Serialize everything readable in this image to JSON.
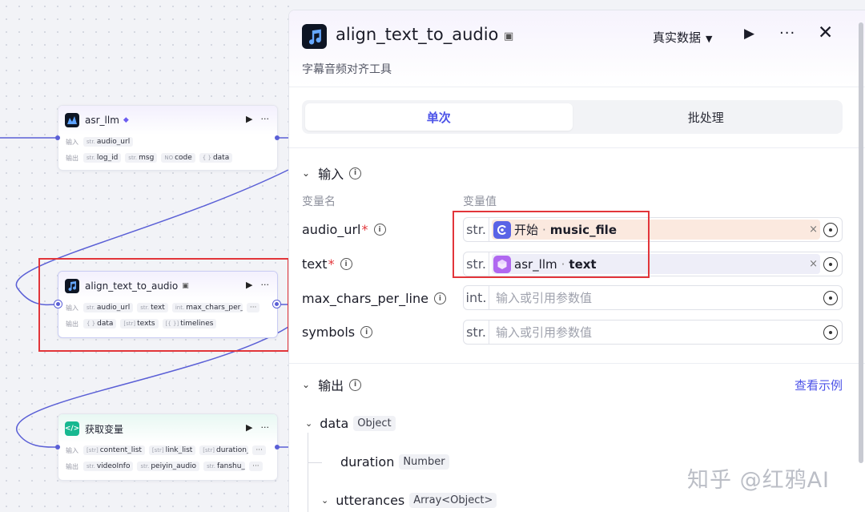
{
  "canvas": {
    "nodes": [
      {
        "title": "asr_llm",
        "badge": "◆",
        "run": "▶",
        "more": "···",
        "input_label": "输入",
        "inputs": [
          {
            "type": "str.",
            "name": "audio_url"
          }
        ],
        "output_label": "输出",
        "outputs": [
          {
            "type": "str.",
            "name": "log_id"
          },
          {
            "type": "str.",
            "name": "msg"
          },
          {
            "type": "NO",
            "name": "code"
          },
          {
            "type": "{ }",
            "name": "data"
          }
        ]
      },
      {
        "title": "align_text_to_audio",
        "badge": "▣",
        "run": "▶",
        "more": "···",
        "input_label": "输入",
        "inputs": [
          {
            "type": "str.",
            "name": "audio_url"
          },
          {
            "type": "str.",
            "name": "text"
          },
          {
            "type": "int.",
            "name": "max_chars_per_"
          }
        ],
        "inputs_more": "···",
        "output_label": "输出",
        "outputs": [
          {
            "type": "{ }",
            "name": "data"
          },
          {
            "type": "[str]",
            "name": "texts"
          },
          {
            "type": "[{ }]",
            "name": "timelines"
          }
        ]
      },
      {
        "title": "获取变量",
        "run": "▶",
        "more": "···",
        "input_label": "输入",
        "inputs": [
          {
            "type": "[str]",
            "name": "content_list"
          },
          {
            "type": "[str]",
            "name": "link_list"
          },
          {
            "type": "[str]",
            "name": "duration_"
          }
        ],
        "inputs_more": "···",
        "output_label": "输出",
        "outputs": [
          {
            "type": "str.",
            "name": "videoInfo"
          },
          {
            "type": "str.",
            "name": "peiyin_audio"
          },
          {
            "type": "str.",
            "name": "fanshu_"
          }
        ],
        "outputs_more": "···"
      }
    ]
  },
  "panel": {
    "title": "align_text_to_audio",
    "title_badge": "▣",
    "subtitle": "字幕音频对齐工具",
    "data_mode": "真实数据",
    "caret": "▼",
    "run_icon": "▶",
    "more_icon": "···",
    "close_icon": "✕",
    "tabs": [
      {
        "label": "单次",
        "active": true
      },
      {
        "label": "批处理",
        "active": false
      }
    ],
    "input_section": {
      "chevron": "⌄",
      "title": "输入",
      "col_name": "变量名",
      "col_value": "变量值",
      "params": [
        {
          "name": "audio_url",
          "required": "*",
          "type": "str.",
          "ref_source": "开始",
          "sep": "·",
          "ref_var": "music_file",
          "clear": "×",
          "placeholder": ""
        },
        {
          "name": "text",
          "required": "*",
          "type": "str.",
          "ref_source": "asr_llm",
          "sep": "·",
          "ref_var": "text",
          "clear": "×",
          "placeholder": ""
        },
        {
          "name": "max_chars_per_line",
          "required": "",
          "type": "int.",
          "placeholder": "输入或引用参数值"
        },
        {
          "name": "symbols",
          "required": "",
          "type": "str.",
          "placeholder": "输入或引用参数值"
        }
      ]
    },
    "output_section": {
      "chevron": "⌄",
      "title": "输出",
      "view_example": "查看示例",
      "items": [
        {
          "chevron": "⌄",
          "name": "data",
          "type": "Object"
        },
        {
          "chevron": "",
          "name": "duration",
          "type": "Number"
        },
        {
          "chevron": "⌄",
          "name": "utterances",
          "type": "Array<Object>"
        }
      ]
    },
    "info_icon": "i"
  },
  "watermark": "知乎 @红鸦AI",
  "colors": {
    "accent": "#4d53e8",
    "edge": "#5a5fd6",
    "highlight_border": "#e2353a",
    "start_ref_bg": "#fbe9df",
    "llm_ref_bg": "#eeeef8"
  }
}
